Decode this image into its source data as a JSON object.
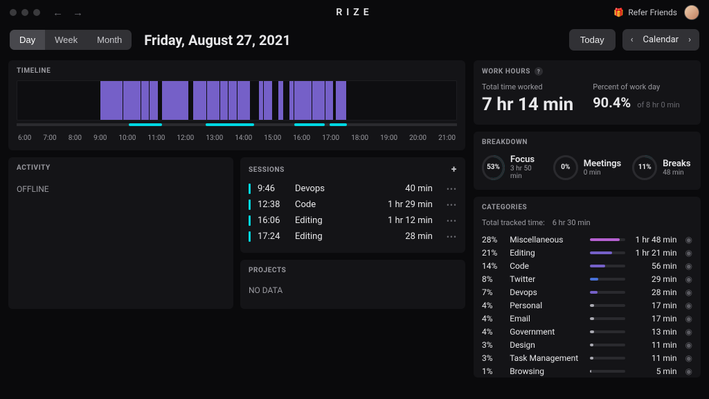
{
  "brand": "RIZE",
  "refer_label": "Refer Friends",
  "view_tabs": {
    "day": "Day",
    "week": "Week",
    "month": "Month"
  },
  "date_title": "Friday, August 27, 2021",
  "today_label": "Today",
  "calendar_label": "Calendar",
  "timeline": {
    "title": "TIMELINE",
    "hours": [
      "6:00",
      "7:00",
      "8:00",
      "9:00",
      "10:00",
      "11:00",
      "12:00",
      "13:00",
      "14:00",
      "15:00",
      "16:00",
      "17:00",
      "18:00",
      "19:00",
      "20:00",
      "21:00"
    ],
    "blocks": [
      {
        "start": 19,
        "end": 32
      },
      {
        "start": 33,
        "end": 39
      },
      {
        "start": 40,
        "end": 53
      },
      {
        "start": 55,
        "end": 58
      },
      {
        "start": 59.5,
        "end": 60.5
      },
      {
        "start": 62,
        "end": 72
      },
      {
        "start": 72.5,
        "end": 75
      }
    ],
    "gaps": [
      24,
      28,
      30,
      43,
      46,
      48,
      50,
      56,
      63,
      67,
      70
    ],
    "segments": [
      {
        "start": 25.5,
        "end": 33
      },
      {
        "start": 43,
        "end": 54
      },
      {
        "start": 63,
        "end": 70
      },
      {
        "start": 71,
        "end": 75
      }
    ]
  },
  "activity": {
    "title": "ACTIVITY",
    "status": "OFFLINE"
  },
  "sessions": {
    "title": "SESSIONS",
    "rows": [
      {
        "time": "9:46",
        "name": "Devops",
        "dur": "40 min"
      },
      {
        "time": "12:38",
        "name": "Code",
        "dur": "1 hr 29 min"
      },
      {
        "time": "16:06",
        "name": "Editing",
        "dur": "1 hr 12 min"
      },
      {
        "time": "17:24",
        "name": "Editing",
        "dur": "28 min"
      }
    ]
  },
  "projects": {
    "title": "PROJECTS",
    "nodata": "NO DATA"
  },
  "work_hours": {
    "title": "WORK HOURS",
    "total_label": "Total time worked",
    "total_value": "7 hr 14 min",
    "pct_label": "Percent of work day",
    "pct_value": "90.4%",
    "of_value": "of 8 hr 0 min"
  },
  "breakdown": {
    "title": "BREAKDOWN",
    "items": [
      {
        "pct": "53%",
        "label": "Focus",
        "sub": "3 hr 50 min",
        "deg": 191,
        "color": "#00d8e2"
      },
      {
        "pct": "0%",
        "label": "Meetings",
        "sub": "0 min",
        "deg": 0,
        "color": "#00d8e2"
      },
      {
        "pct": "11%",
        "label": "Breaks",
        "sub": "48 min",
        "deg": 40,
        "color": "#00d8e2"
      }
    ]
  },
  "categories": {
    "title": "CATEGORIES",
    "tracked_label": "Total tracked time:",
    "tracked_value": "6 hr 30 min",
    "rows": [
      {
        "pct": "28%",
        "name": "Miscellaneous",
        "dur": "1 hr 48 min",
        "w": 28,
        "color": "#b560d0"
      },
      {
        "pct": "21%",
        "name": "Editing",
        "dur": "1 hr 21 min",
        "w": 21,
        "color": "#7560c8"
      },
      {
        "pct": "14%",
        "name": "Code",
        "dur": "56 min",
        "w": 14,
        "color": "#7560c8"
      },
      {
        "pct": "8%",
        "name": "Twitter",
        "dur": "29 min",
        "w": 8,
        "color": "#4870d8"
      },
      {
        "pct": "7%",
        "name": "Devops",
        "dur": "28 min",
        "w": 7,
        "color": "#7560c8"
      },
      {
        "pct": "4%",
        "name": "Personal",
        "dur": "17 min",
        "w": 4,
        "color": "#a8a8b0"
      },
      {
        "pct": "4%",
        "name": "Email",
        "dur": "17 min",
        "w": 4,
        "color": "#a8a8b0"
      },
      {
        "pct": "4%",
        "name": "Government",
        "dur": "13 min",
        "w": 4,
        "color": "#a8a8b0"
      },
      {
        "pct": "3%",
        "name": "Design",
        "dur": "11 min",
        "w": 3,
        "color": "#a8a8b0"
      },
      {
        "pct": "3%",
        "name": "Task Management",
        "dur": "11 min",
        "w": 3,
        "color": "#a8a8b0"
      },
      {
        "pct": "1%",
        "name": "Browsing",
        "dur": "5 min",
        "w": 1,
        "color": "#a8a8b0"
      }
    ]
  }
}
